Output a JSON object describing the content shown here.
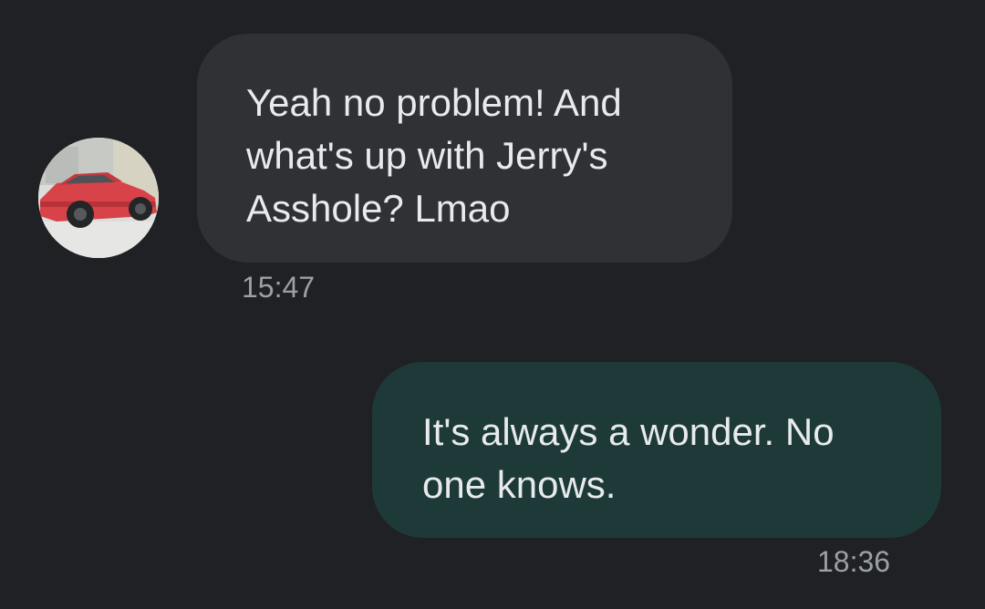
{
  "conversation": {
    "messages": [
      {
        "direction": "incoming",
        "text": "Yeah no problem! And\nwhat's up with Jerry's\nAsshole? Lmao",
        "time": "15:47",
        "avatar": "red-car-photo"
      },
      {
        "direction": "outgoing",
        "text": "It's always a wonder. No\none knows.",
        "time": "18:36"
      }
    ]
  },
  "colors": {
    "background": "#202124",
    "incoming_bubble": "#303134",
    "outgoing_bubble": "#1d3a39",
    "message_text": "#e8eaed",
    "timestamp_text": "#9aa0a6"
  }
}
